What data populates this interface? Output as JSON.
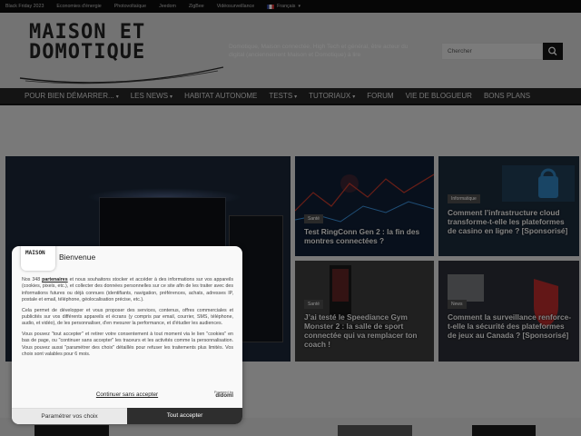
{
  "topbar": {
    "links": [
      "Black Friday 2023",
      "Economies d'énergie",
      "Photovoltaïque",
      "Jeedom",
      "ZigBee",
      "Vidéosurveillance"
    ],
    "language": "Français"
  },
  "header": {
    "logo_line1": "MAISON ET",
    "logo_line2": "DOMOTIQUE",
    "tagline": "Domotique, Maison connectée, High Tech et général, être acteur du digital (anciennement Maison et Domotique) à lire",
    "search_placeholder": "Chercher"
  },
  "nav": {
    "items": [
      {
        "label": "POUR BIEN DÉMARRER...",
        "dropdown": true
      },
      {
        "label": "LES NEWS",
        "dropdown": true
      },
      {
        "label": "HABITAT AUTONOME",
        "dropdown": false
      },
      {
        "label": "TESTS",
        "dropdown": true
      },
      {
        "label": "TUTORIAUX",
        "dropdown": true
      },
      {
        "label": "FORUM",
        "dropdown": false
      },
      {
        "label": "VIE DE BLOGUEUR",
        "dropdown": false
      },
      {
        "label": "BONS PLANS",
        "dropdown": false
      }
    ]
  },
  "articles": [
    {
      "badge": "Santé",
      "title": "Test RingConn Gen 2 : la fin des montres connectées ?"
    },
    {
      "badge": "Informatique",
      "title": "Comment l’infrastructure cloud transforme-t-elle les plateformes de casino en ligne ? [Sponsorisé]"
    },
    {
      "badge": "Santé",
      "title": "J’ai testé le Speediance Gym Monster 2 : la salle de sport connectée qui va remplacer ton coach !"
    },
    {
      "badge": "News",
      "title": "Comment la surveillance renforce-t-elle la sécurité des plateformes de jeux au Canada ? [Sponsorisé]"
    }
  ],
  "consent": {
    "logo_text": "MAISON",
    "title": "Bienvenue",
    "paragraph1_pre": "Nos 348 ",
    "paragraph1_link": "partenaires",
    "paragraph1_post": " et nous souhaitons stocker et accéder à des informations sur vos appareils (cookies, pixels, etc.), et collecter des données personnelles sur ce site afin de les traiter avec des informations futures ou déjà connues (identifiants, navigation, préférences, achats, adresses IP, postale et email, téléphone, géolocalisation précise, etc.).",
    "paragraph2": "Cela permet de développer et vous proposer des services, contenus, offres commerciales et publicités sur vos différents appareils et écrans (y compris par email, courrier, SMS, téléphone, audio, et vidéo), de les personnaliser, d'en mesurer la performance, et d'étudier les audiences.",
    "paragraph3": "Vous pouvez \"tout accepter\" et retirer votre consentement à tout moment via le lien \"cookies\" en bas de page, ou \"continuer sans accepter\" les traceurs et les activités comme la personnalisation. Vous pouvez aussi \"paramétrer des choix\" détaillés pour refuser les traitements plus limités. Vos choix sont valables pour 6 mois.",
    "continue_label": "Continuer sans accepter",
    "powered_by": "Powered by",
    "powered_brand": "didomi",
    "settings_label": "Paramétrer vos choix",
    "accept_label": "Tout accepter"
  },
  "colors": {
    "nav_bg": "#262626",
    "accept_bg": "#2e2e2e",
    "overlay": "rgba(0,0,0,0.45)"
  }
}
